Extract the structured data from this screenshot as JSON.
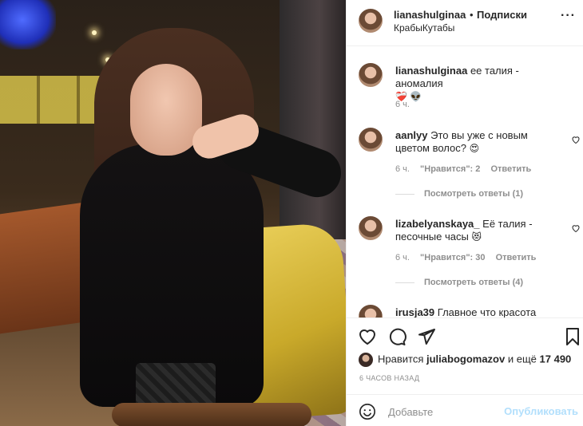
{
  "post": {
    "author": "lianashulginaa",
    "separator": "•",
    "follow_label": "Подписки",
    "location": "КрабыКутабы",
    "more_icon": "more-horizontal-icon",
    "more_label": "···"
  },
  "caption": {
    "username": "lianashulginaa",
    "text": "ее талия - аномалия",
    "emojis": "❤️‍🩹 👽",
    "time": "6 ч."
  },
  "comments": [
    {
      "username": "aanlyy",
      "text": "Это вы уже с новым цветом волос?",
      "emoji": "😍",
      "time": "6 ч.",
      "likes": "\"Нравится\": 2",
      "reply_label": "Ответить",
      "view_replies": "Посмотреть ответы (1)"
    },
    {
      "username": "lizabelyanskaya_",
      "text": "Её талия - песочные часы",
      "emoji": "😻",
      "time": "6 ч.",
      "likes": "\"Нравится\": 30",
      "reply_label": "Ответить",
      "view_replies": "Посмотреть ответы (4)"
    },
    {
      "username": "irusja39",
      "text": "Главное что красота"
    }
  ],
  "likes_line": {
    "prefix": "Нравится",
    "user": "juliabogomazov",
    "suffix": "и ещё",
    "count": "17 490"
  },
  "time_ago": "6 ЧАСОВ НАЗАД",
  "add_comment": {
    "placeholder": "Добавьте",
    "publish_label": "Опубликовать"
  },
  "colors": {
    "text": "#262626",
    "muted": "#8e8e8e",
    "publish_disabled": "#b2dffc"
  }
}
